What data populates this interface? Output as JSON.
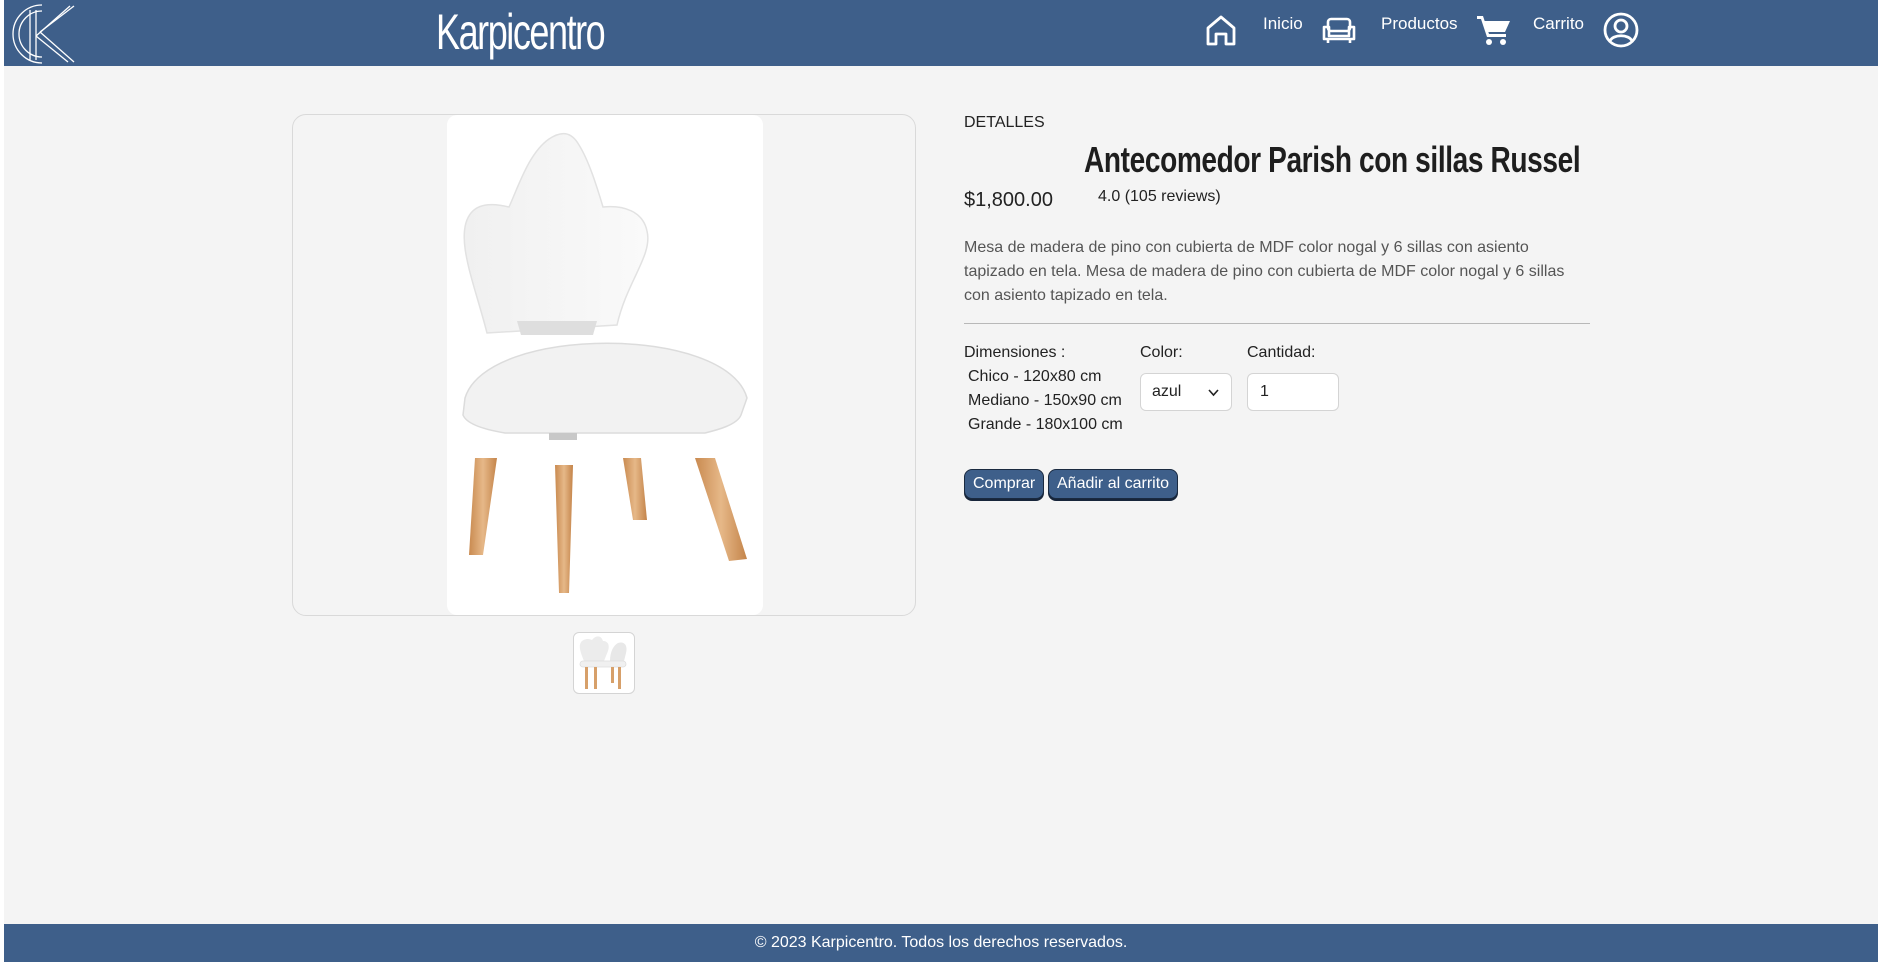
{
  "header": {
    "brand": "Karpicentro",
    "nav": [
      {
        "label": "Inicio",
        "icon": "home-icon"
      },
      {
        "label": "Productos",
        "icon": "sofa-icon"
      },
      {
        "label": "Carrito",
        "icon": "cart-icon"
      }
    ],
    "account_icon": "user-icon"
  },
  "product": {
    "section_label": "DETALLES",
    "title": "Antecomedor Parish con sillas Russel",
    "price": "$1,800.00",
    "rating": "4.0 (105 reviews)",
    "description": "Mesa de madera de pino con cubierta de MDF color nogal y 6 sillas con asiento tapizado en tela. Mesa de madera de pino con cubierta de MDF color nogal y 6 sillas con asiento tapizado en tela.",
    "dimensions_label": "Dimensiones :",
    "dimensions": [
      "Chico - 120x80 cm",
      "Mediano - 150x90 cm",
      "Grande - 180x100 cm"
    ],
    "color_label": "Color:",
    "color_value": "azul",
    "quantity_label": "Cantidad:",
    "quantity_value": "1",
    "buy_label": "Comprar",
    "add_to_cart_label": "Añadir al carrito"
  },
  "footer": {
    "text": "© 2023 Karpicentro. Todos los derechos reservados."
  },
  "colors": {
    "primary": "#3e5f8a",
    "background": "#f4f4f4"
  }
}
